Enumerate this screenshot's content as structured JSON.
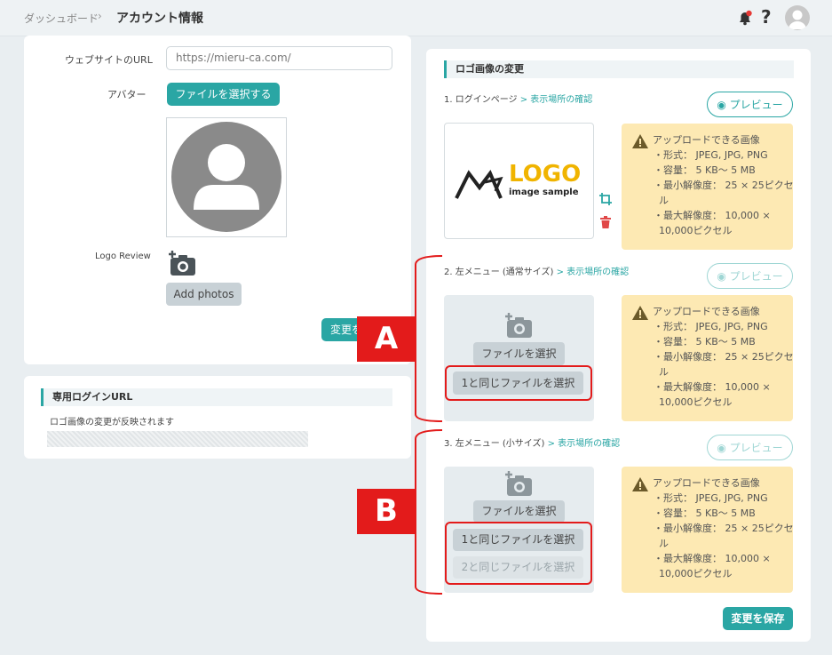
{
  "header": {
    "breadcrumb_home": "ダッシュボード",
    "breadcrumb_sep": "›",
    "breadcrumb_current": "アカウント情報",
    "help": "?"
  },
  "profile": {
    "website_label": "ウェブサイトのURL",
    "website_value": "https://mieru-ca.com/",
    "avatar_label": "アバター",
    "avatar_button": "ファイルを選択する",
    "logo_review_label": "Logo Review",
    "add_photos": "Add photos",
    "change_button": "変更を"
  },
  "login_url": {
    "title": "専用ログインURL",
    "note": "ロゴ画像の変更が反映されます"
  },
  "logo_section": {
    "title": "ロゴ画像の変更",
    "preview_label": "プレビュー",
    "link_label": "> 表示場所の確認",
    "logo_text": "LOGO",
    "logo_sub": "image sample",
    "items": [
      {
        "step": "1. ログインページ"
      },
      {
        "step": "2. 左メニュー (通常サイズ)"
      },
      {
        "step": "3. 左メニュー (小サイズ)"
      }
    ],
    "select_file": "ファイルを選択",
    "same_as_1": "1と同じファイルを選択",
    "same_as_2": "2と同じファイルを選択",
    "info": {
      "title": "アップロードできる画像",
      "format": "・形式： JPEG, JPG, PNG",
      "size": "・容量：  5 KB～ 5 MB",
      "min_res": "・最小解像度： 25 × 25ピクセ",
      "min_res_cont": "ル",
      "max_res": "・最大解像度： 10,000 ×",
      "max_res_cont": "10,000ピクセル"
    },
    "save_button": "変更を保存"
  },
  "annotations": {
    "a": "A",
    "b": "B"
  },
  "colors": {
    "accent": "#2aa6a4",
    "highlight": "#e31b1b",
    "info_bg": "#fde9b3"
  }
}
